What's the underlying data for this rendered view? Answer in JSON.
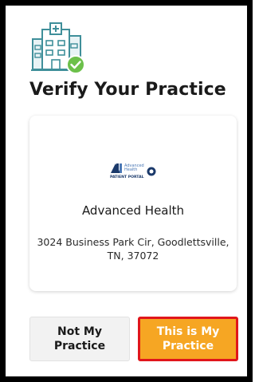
{
  "page": {
    "title": "Verify Your Practice"
  },
  "practice": {
    "logo_icon": "advanced-health-patient-portal-logo",
    "logo_text_small": "Advanced Health",
    "logo_text_portal": "PATIENT PORTAL",
    "name": "Advanced Health",
    "address": "3024 Business Park Cir, Goodlettsville, TN, 37072"
  },
  "actions": {
    "not_my_practice_label": "Not My Practice",
    "this_is_my_practice_label": "This is My Practice"
  },
  "colors": {
    "accent": "#f6a623",
    "highlight_border": "#e0161b",
    "icon_teal": "#3f8f9a",
    "icon_check": "#6cc04a"
  },
  "icons": {
    "hero": "hospital-verified-icon"
  }
}
